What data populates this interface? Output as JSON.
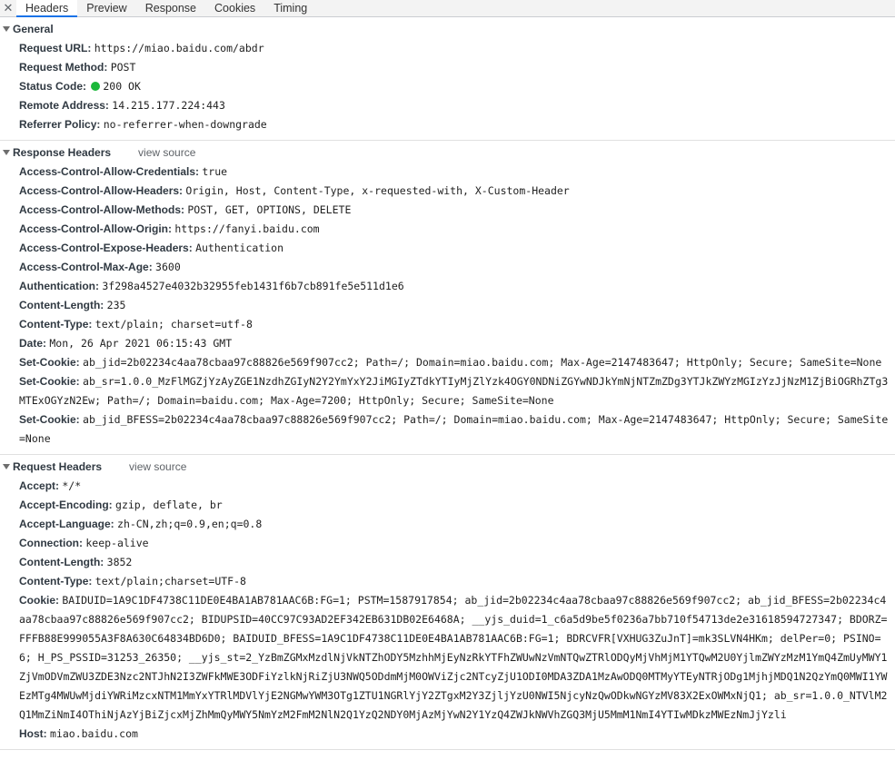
{
  "tabs": {
    "close": "✕",
    "items": [
      "Headers",
      "Preview",
      "Response",
      "Cookies",
      "Timing"
    ]
  },
  "status_color": "#1bb83a",
  "view_source": "view source",
  "general": {
    "title": "General",
    "rows": [
      {
        "key": "Request URL:",
        "value": "https://miao.baidu.com/abdr"
      },
      {
        "key": "Request Method:",
        "value": "POST"
      },
      {
        "key": "Status Code:",
        "value": "200 OK"
      },
      {
        "key": "Remote Address:",
        "value": "14.215.177.224:443"
      },
      {
        "key": "Referrer Policy:",
        "value": "no-referrer-when-downgrade"
      }
    ]
  },
  "response_headers": {
    "title": "Response Headers",
    "rows": [
      {
        "key": "Access-Control-Allow-Credentials:",
        "value": "true"
      },
      {
        "key": "Access-Control-Allow-Headers:",
        "value": "Origin, Host, Content-Type, x-requested-with, X-Custom-Header"
      },
      {
        "key": "Access-Control-Allow-Methods:",
        "value": "POST, GET, OPTIONS, DELETE"
      },
      {
        "key": "Access-Control-Allow-Origin:",
        "value": "https://fanyi.baidu.com"
      },
      {
        "key": "Access-Control-Expose-Headers:",
        "value": "Authentication"
      },
      {
        "key": "Access-Control-Max-Age:",
        "value": "3600"
      },
      {
        "key": "Authentication:",
        "value": "3f298a4527e4032b32955feb1431f6b7cb891fe5e511d1e6"
      },
      {
        "key": "Content-Length:",
        "value": "235"
      },
      {
        "key": "Content-Type:",
        "value": "text/plain; charset=utf-8"
      },
      {
        "key": "Date:",
        "value": "Mon, 26 Apr 2021 06:15:43 GMT"
      },
      {
        "key": "Set-Cookie:",
        "value": "ab_jid=2b02234c4aa78cbaa97c88826e569f907cc2; Path=/; Domain=miao.baidu.com; Max-Age=2147483647; HttpOnly; Secure; SameSite=None"
      },
      {
        "key": "Set-Cookie:",
        "value": "ab_sr=1.0.0_MzFlMGZjYzAyZGE1NzdhZGIyN2Y2YmYxY2JiMGIyZTdkYTIyMjZlYzk4OGY0NDNiZGYwNDJkYmNjNTZmZDg3YTJkZWYzMGIzYzJjNzM1ZjBiOGRhZTg3MTExOGYzN2Ew; Path=/; Domain=baidu.com; Max-Age=7200; HttpOnly; Secure; SameSite=None"
      },
      {
        "key": "Set-Cookie:",
        "value": "ab_jid_BFESS=2b02234c4aa78cbaa97c88826e569f907cc2; Path=/; Domain=miao.baidu.com; Max-Age=2147483647; HttpOnly; Secure; SameSite=None"
      }
    ]
  },
  "request_headers": {
    "title": "Request Headers",
    "rows": [
      {
        "key": "Accept:",
        "value": "*/*"
      },
      {
        "key": "Accept-Encoding:",
        "value": "gzip, deflate, br"
      },
      {
        "key": "Accept-Language:",
        "value": "zh-CN,zh;q=0.9,en;q=0.8"
      },
      {
        "key": "Connection:",
        "value": "keep-alive"
      },
      {
        "key": "Content-Length:",
        "value": "3852"
      },
      {
        "key": "Content-Type:",
        "value": "text/plain;charset=UTF-8"
      },
      {
        "key": "Cookie:",
        "value": "BAIDUID=1A9C1DF4738C11DE0E4BA1AB781AAC6B:FG=1; PSTM=1587917854; ab_jid=2b02234c4aa78cbaa97c88826e569f907cc2; ab_jid_BFESS=2b02234c4aa78cbaa97c88826e569f907cc2; BIDUPSID=40CC97C93AD2EF342EB631DB02E6468A; __yjs_duid=1_c6a5d9be5f0236a7bb710f54713de2e31618594727347; BDORZ=FFFB88E999055A3F8A630C64834BD6D0; BAIDUID_BFESS=1A9C1DF4738C11DE0E4BA1AB781AAC6B:FG=1; BDRCVFR[VXHUG3ZuJnT]=mk3SLVN4HKm; delPer=0; PSINO=6; H_PS_PSSID=31253_26350; __yjs_st=2_YzBmZGMxMzdlNjVkNTZhODY5MzhhMjEyNzRkYTFhZWUwNzVmNTQwZTRlODQyMjVhMjM1YTQwM2U0YjlmZWYzMzM1YmQ4ZmUyMWY1ZjVmODVmZWU3ZDE3Nzc2NTJhN2I3ZWFkMWE3ODFiYzlkNjRiZjU3NWQ5ODdmMjM0OWViZjc2NTcyZjU1ODI0MDA3ZDA1MzAwODQ0MTMyYTEyNTRjODg1MjhjMDQ1N2QzYmQ0MWI1YWEzMTg4MWUwMjdiYWRiMzcxNTM1MmYxYTRlMDVlYjE2NGMwYWM3OTg1ZTU1NGRlYjY2ZTgxM2Y3ZjljYzU0NWI5NjcyNzQwODkwNGYzMV83X2ExOWMxNjQ1; ab_sr=1.0.0_NTVlM2Q1MmZiNmI4OThiNjAzYjBiZjcxMjZhMmQyMWY5NmYzM2FmM2NlN2Q1YzQ2NDY0MjAzMjYwN2Y1YzQ4ZWJkNWVhZGQ3MjU5MmM1NmI4YTIwMDkzMWEzNmJjYzli"
      },
      {
        "key": "Host:",
        "value": "miao.baidu.com"
      }
    ]
  }
}
